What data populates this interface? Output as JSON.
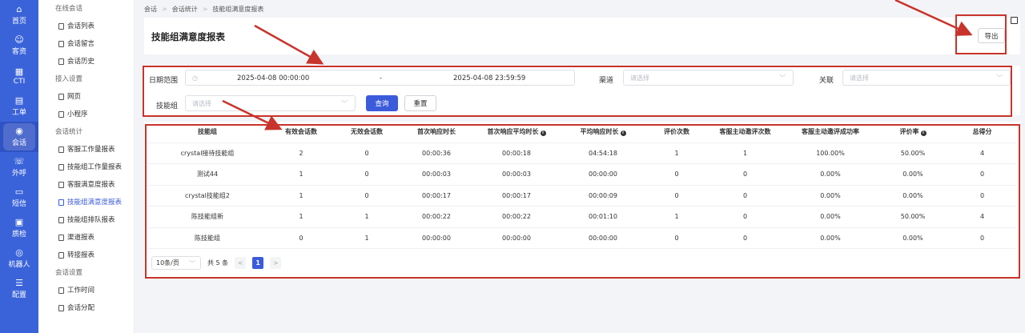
{
  "rail": [
    {
      "label": "首页",
      "icon": "home-icon",
      "glyph": "⌂"
    },
    {
      "label": "客资",
      "icon": "customer-icon",
      "glyph": "☺"
    },
    {
      "label": "CTI",
      "icon": "cti-icon",
      "glyph": "▦"
    },
    {
      "label": "工单",
      "icon": "ticket-icon",
      "glyph": "▤"
    },
    {
      "label": "会话",
      "icon": "chat-icon",
      "glyph": "◉"
    },
    {
      "label": "外呼",
      "icon": "phone-icon",
      "glyph": "☏"
    },
    {
      "label": "短信",
      "icon": "sms-icon",
      "glyph": "▭"
    },
    {
      "label": "质检",
      "icon": "quality-icon",
      "glyph": "▣"
    },
    {
      "label": "机器人",
      "icon": "robot-icon",
      "glyph": "◎"
    },
    {
      "label": "配置",
      "icon": "settings-icon",
      "glyph": "☰"
    }
  ],
  "subnav": {
    "groups": [
      {
        "title": "在线会话",
        "items": [
          "会话列表",
          "会话留言",
          "会话历史"
        ]
      },
      {
        "title": "接入设置",
        "items": [
          "网页",
          "小程序"
        ]
      },
      {
        "title": "会话统计",
        "items": [
          "客服工作量报表",
          "技能组工作量报表",
          "客服满意度报表",
          "技能组满意度报表",
          "技能组排队报表",
          "渠道报表",
          "转接报表"
        ]
      },
      {
        "title": "会话设置",
        "items": [
          "工作时间",
          "会话分配"
        ]
      }
    ],
    "active": "技能组满意度报表"
  },
  "breadcrumb": [
    "会话",
    "会话统计",
    "技能组满意度报表"
  ],
  "page_title": "技能组满意度报表",
  "export_label": "导出",
  "filters": {
    "date_label": "日期范围",
    "date_start": "2025-04-08 00:00:00",
    "date_sep": "-",
    "date_end": "2025-04-08 23:59:59",
    "channel_label": "渠道",
    "channel_placeholder": "请选择",
    "relation_label": "关联",
    "relation_placeholder": "请选择",
    "skill_label": "技能组",
    "skill_placeholder": "请选择",
    "query_label": "查询",
    "reset_label": "重置"
  },
  "table": {
    "headers": [
      "技能组",
      "有效会话数",
      "无效会话数",
      "首次响应时长",
      "首次响应平均时长",
      "平均响应时长",
      "评价次数",
      "客服主动邀评次数",
      "客服主动邀评成功率",
      "评价率",
      "总得分"
    ],
    "info_cols": [
      4,
      5,
      9
    ],
    "rows": [
      [
        "crystal接待技能组",
        "2",
        "0",
        "00:00:36",
        "00:00:18",
        "04:54:18",
        "1",
        "1",
        "100.00%",
        "50.00%",
        "4"
      ],
      [
        "测试44",
        "1",
        "0",
        "00:00:03",
        "00:00:03",
        "00:00:00",
        "0",
        "0",
        "0.00%",
        "0.00%",
        "0"
      ],
      [
        "crystal技能组2",
        "1",
        "0",
        "00:00:17",
        "00:00:17",
        "00:00:09",
        "0",
        "0",
        "0.00%",
        "0.00%",
        "0"
      ],
      [
        "陈技能组新",
        "1",
        "1",
        "00:00:22",
        "00:00:22",
        "00:01:10",
        "1",
        "0",
        "0.00%",
        "50.00%",
        "4"
      ],
      [
        "陈技能组",
        "0",
        "1",
        "00:00:00",
        "00:00:00",
        "00:00:00",
        "0",
        "0",
        "0.00%",
        "0.00%",
        "0"
      ]
    ]
  },
  "pager": {
    "page_size": "10条/页",
    "total": "共 5 条",
    "prev": "<",
    "current": "1",
    "next": ">"
  },
  "colors": {
    "accent": "#3b5bdb",
    "rail": "#3b63d9",
    "annotation": "#c8342b"
  }
}
